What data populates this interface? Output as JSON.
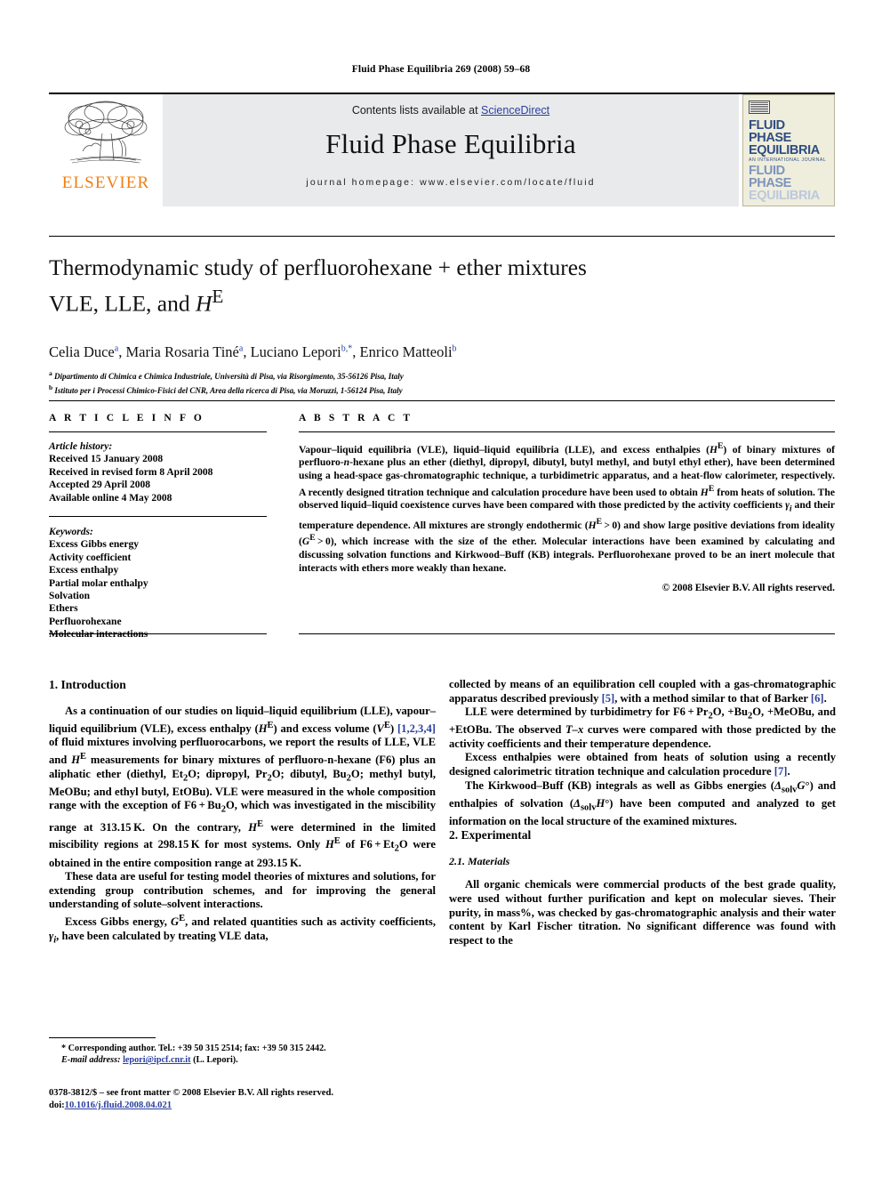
{
  "running_head": "Fluid Phase Equilibria 269 (2008) 59–68",
  "masthead": {
    "contents_prefix": "Contents lists available at ",
    "sciencedirect": "ScienceDirect",
    "journal_name": "Fluid Phase Equilibria",
    "homepage": "journal homepage: www.elsevier.com/locate/fluid",
    "publisher_name": "ELSEVIER",
    "publisher_color": "#f07f13",
    "link_color": "#2b3f9e",
    "cover": {
      "line1": "FLUID PHASE",
      "line2": "EQUILIBRIA",
      "subtitle": "AN INTERNATIONAL JOURNAL",
      "line3": "FLUID PHASE",
      "line4": "EQUILIBRIA"
    }
  },
  "title": {
    "line1": "Thermodynamic study of perfluorohexane + ether mixtures",
    "line2_prefix": "VLE, LLE, and ",
    "line2_italic": "H",
    "line2_sup": "E"
  },
  "authors": [
    {
      "name": "Celia Duce",
      "marks": "a"
    },
    {
      "name": "Maria Rosaria Tiné",
      "marks": "a"
    },
    {
      "name": "Luciano Lepori",
      "marks": "b,*"
    },
    {
      "name": "Enrico Matteoli",
      "marks": "b"
    }
  ],
  "affiliations": [
    {
      "mark": "a",
      "text": "Dipartimento di Chimica e Chimica Industriale, Università di Pisa, via Risorgimento, 35-56126 Pisa, Italy"
    },
    {
      "mark": "b",
      "text": "Istituto per i Processi Chimico-Fisici del CNR, Area della ricerca di Pisa, via Moruzzi, 1-56124 Pisa, Italy"
    }
  ],
  "article_info": {
    "heading": "A R T I C L E   I N F O",
    "history_label": "Article history:",
    "history": [
      "Received 15 January 2008",
      "Received in revised form 8 April 2008",
      "Accepted 29 April 2008",
      "Available online 4 May 2008"
    ],
    "keywords_label": "Keywords:",
    "keywords": [
      "Excess Gibbs energy",
      "Activity coefficient",
      "Excess enthalpy",
      "Partial molar enthalpy",
      "Solvation",
      "Ethers",
      "Perfluorohexane",
      "Molecular interactions"
    ]
  },
  "abstract": {
    "heading": "A B S T R A C T",
    "copyright": "© 2008 Elsevier B.V. All rights reserved."
  },
  "sections": {
    "introduction_heading": "1.  Introduction",
    "experimental_heading": "2.  Experimental",
    "materials_heading": "2.1.  Materials"
  },
  "footnote": {
    "corresponding": "* Corresponding author. Tel.: +39 50 315 2514; fax: +39 50 315 2442.",
    "email_label": "E-mail address:",
    "email": "lepori@ipcf.cnr.it",
    "email_owner": "(L. Lepori).",
    "frontmatter": "0378-3812/$ – see front matter © 2008 Elsevier B.V. All rights reserved.",
    "doi_label": "doi:",
    "doi": "10.1016/j.fluid.2008.04.021"
  }
}
